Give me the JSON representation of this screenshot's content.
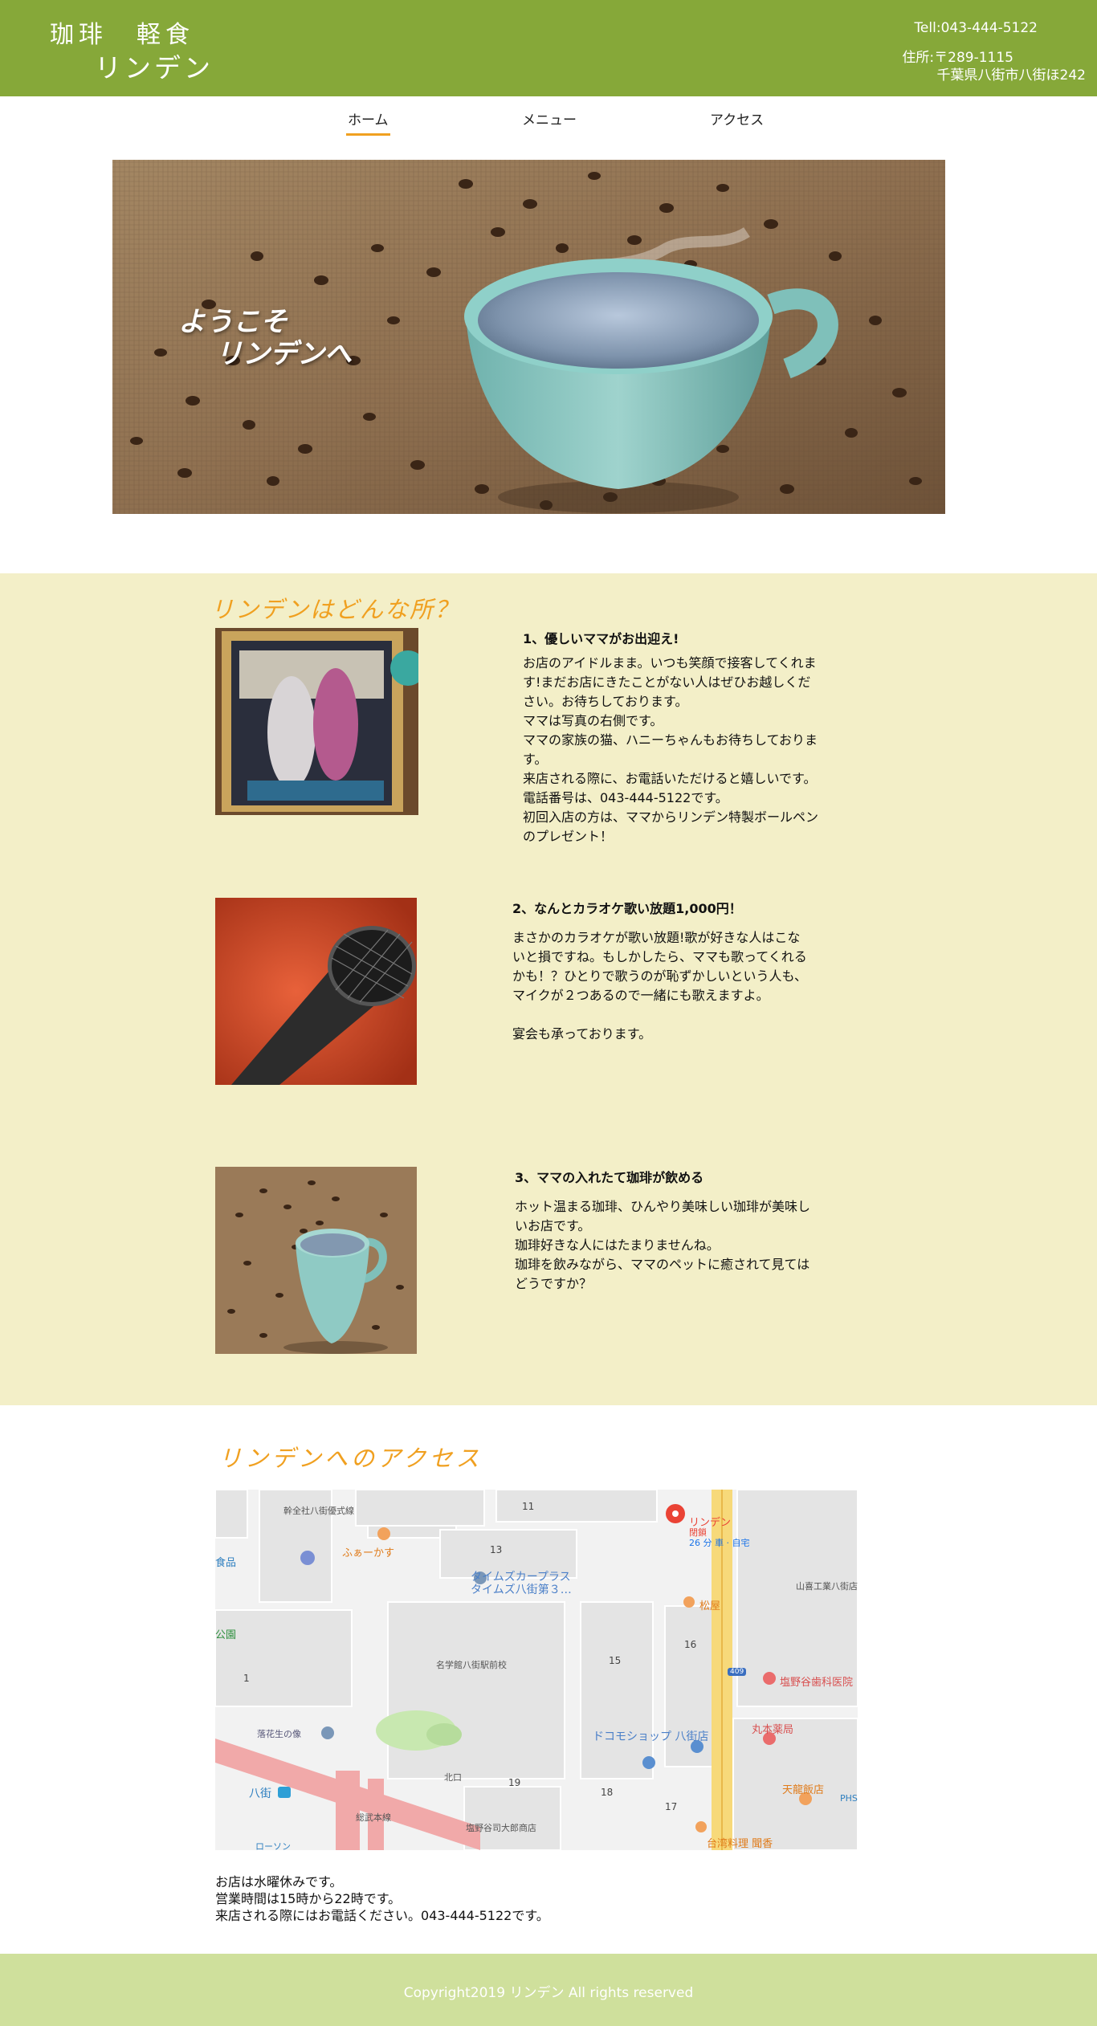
{
  "header": {
    "logo_line1": "珈琲　軽食",
    "logo_line2": "リンデン",
    "tel": "Tell:043-444-5122",
    "address_line1": "住所:〒289-1115",
    "address_line2": "千葉県八街市八街ほ242"
  },
  "nav": {
    "items": [
      {
        "label": "ホーム",
        "active": true
      },
      {
        "label": "メニュー",
        "active": false
      },
      {
        "label": "アクセス",
        "active": false
      }
    ]
  },
  "hero": {
    "title_line1": "ようこそ",
    "title_line2": "リンデンへ"
  },
  "about": {
    "title": "リンデンはどんな所？",
    "features": [
      {
        "heading": "1、優しいママがお出迎え!",
        "text": "お店のアイドルまま。いつも笑顔で接客してくれま\nす!まだお店にきたことがない人はぜひお越しくだ\nさい。お待ちしております。\nママは写真の右側です。\nママの家族の猫、ハニーちゃんもお待ちしておりま\nす。\n来店される際に、お電話いただけると嬉しいです。\n電話番号は、043-444-5122です。\n初回入店の方は、ママからリンデン特製ボールペン\nのプレゼント！"
      },
      {
        "heading": "2、なんとカラオケ歌い放題1,000円！",
        "text": "まさかのカラオケが歌い放題!歌が好きな人はこな\nいと損ですね。もしかしたら、ママも歌ってくれる\nかも！？ひとりで歌うのが恥ずかしいという人も、\nマイクが２つあるので一緒にも歌えますよ。\n\n宴会も承っております。"
      },
      {
        "heading": "3、ママの入れたて珈琲が飲める",
        "text": "ホット温まる珈琲、ひんやり美味しい珈琲が美味し\nいお店です。\n珈琲好きな人にはたまりませんね。\n珈琲を飲みながら、ママのペットに癒されて見ては\nどうですか？"
      }
    ]
  },
  "access": {
    "title": "リンデンへのアクセス",
    "map_labels": {
      "place_top": "幹全社八街優式線",
      "fugu": "ふぁーかす",
      "times": "タイムズカープラス",
      "times2": "タイムズ八街第３…",
      "linden": "リンデン",
      "closed": "閉鎖",
      "minutes": "26 分 車 · 自宅",
      "matsuya": "松屋",
      "sanyo": "山喜工業八街店",
      "school": "名学館八街駅前校",
      "shionoya": "塩野谷歯科医院",
      "marumoto": "丸本薬局",
      "docomo": "ドコモショップ 八街店",
      "tenryu": "天龍飯店",
      "taiwan": "台湾料理 聞香",
      "rakuka": "落花生の像",
      "yachimata": "八街",
      "kitaguchi": "北口",
      "sobu": "総武本線",
      "eki": "塩野谷司大郎商店",
      "shokuhin": "食品",
      "park": "公園",
      "lawson": "ローソン",
      "phs": "PHS",
      "route": "409",
      "n11": "11",
      "n13": "13",
      "n15": "15",
      "n16": "16",
      "n17": "17",
      "n18": "18",
      "n19": "19",
      "n1": "1"
    },
    "closed_day": "お店は水曜休みです。",
    "hours": "営業時間は15時から22時です。",
    "call": "来店される際にはお電話ください。043-444-5122です。"
  },
  "footer": {
    "copyright": "Copyright2019 リンデン All rights reserved"
  },
  "colors": {
    "header_bg": "#86a839",
    "about_bg": "#f3efc8",
    "footer_bg": "#cfe09c",
    "accent": "#f0a020"
  }
}
